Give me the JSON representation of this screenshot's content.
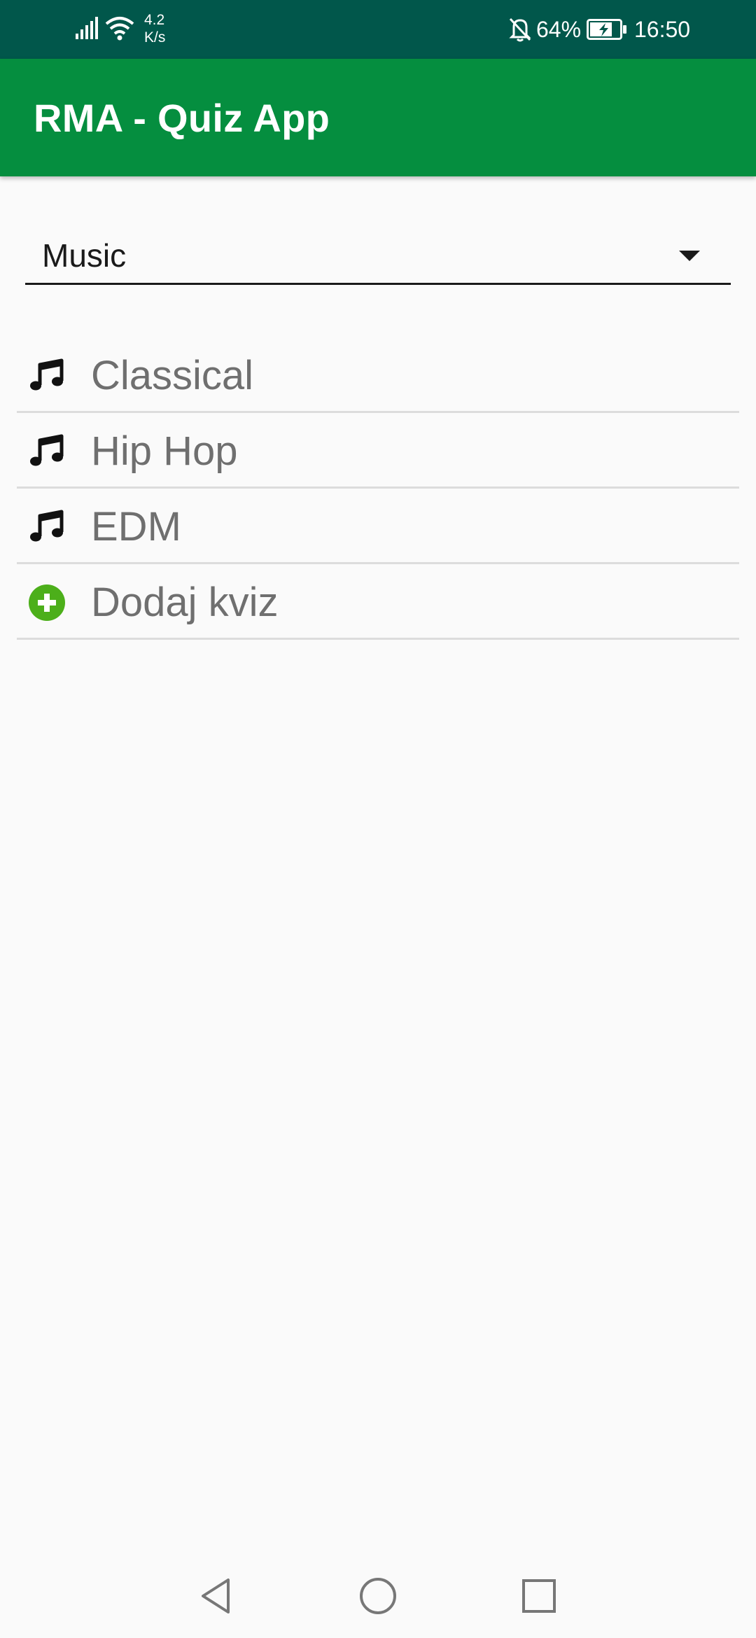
{
  "status_bar": {
    "net_speed_value": "4.2",
    "net_speed_unit": "K/s",
    "battery_percent": "64%",
    "time": "16:50",
    "icons": [
      "signal-icon",
      "wifi-icon",
      "bell-off-icon",
      "battery-charging-icon"
    ]
  },
  "app_bar": {
    "title": "RMA - Quiz App"
  },
  "category_spinner": {
    "selected": "Music"
  },
  "quiz_list": {
    "items": [
      {
        "label": "Classical",
        "icon": "music-note-icon"
      },
      {
        "label": "Hip Hop",
        "icon": "music-note-icon"
      },
      {
        "label": "EDM",
        "icon": "music-note-icon"
      },
      {
        "label": "Dodaj kviz",
        "icon": "add-circle-icon"
      }
    ]
  },
  "nav_bar": {
    "icons": [
      "back-icon",
      "home-icon",
      "recents-icon"
    ]
  },
  "colors": {
    "status_bar": "#01574b",
    "app_bar": "#058e3f",
    "add_icon": "#4caf1a",
    "background": "#fafafa"
  }
}
